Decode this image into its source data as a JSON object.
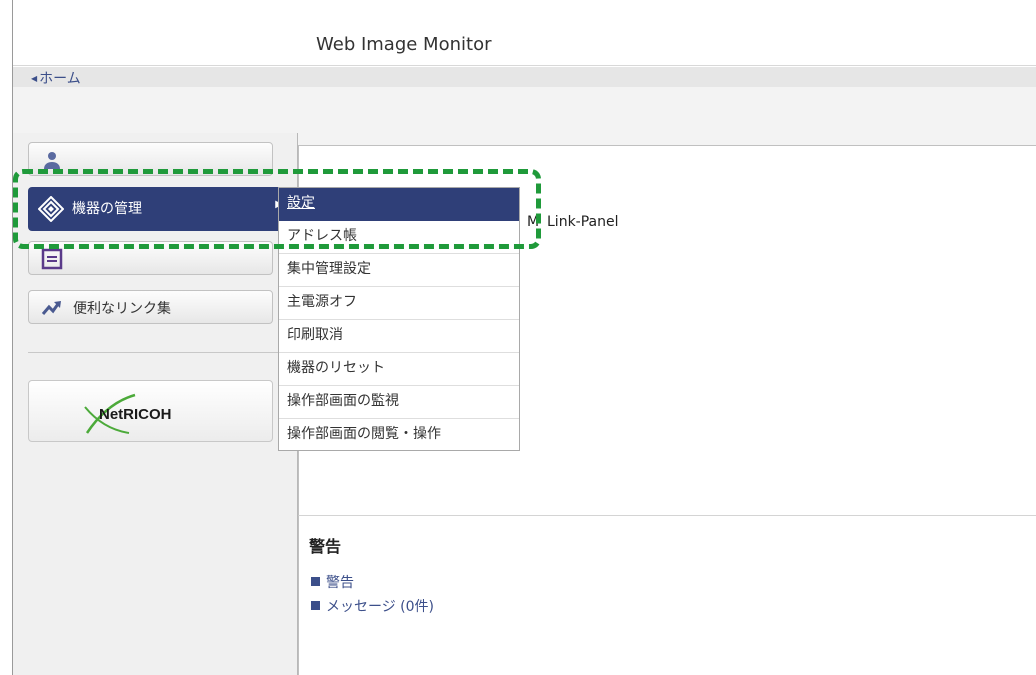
{
  "app": {
    "title": "Web Image Monitor"
  },
  "breadcrumb": {
    "home": "ホーム"
  },
  "sidebar": {
    "items": [
      {
        "label": "",
        "icon": "user-icon"
      },
      {
        "label": "機器の管理",
        "icon": "device-management-icon"
      },
      {
        "label": "",
        "icon": "job-icon"
      },
      {
        "label": "便利なリンク集",
        "icon": "link-arrow-icon"
      }
    ],
    "logo_text": "NetRICOH"
  },
  "dropdown": {
    "items": [
      "設定",
      "アドレス帳",
      "集中管理設定",
      "主電源オフ",
      "印刷取消",
      "機器のリセット",
      "操作部画面の監視",
      "操作部画面の閲覧・操作"
    ]
  },
  "main": {
    "status_fragment": "M",
    "right_label": "Link-Panel"
  },
  "alerts": {
    "title": "警告",
    "links": [
      "警告",
      "メッセージ (0件)"
    ]
  },
  "colors": {
    "accent": "#2f3f78",
    "link": "#3c4f8a",
    "highlight": "#1f9a3a"
  }
}
